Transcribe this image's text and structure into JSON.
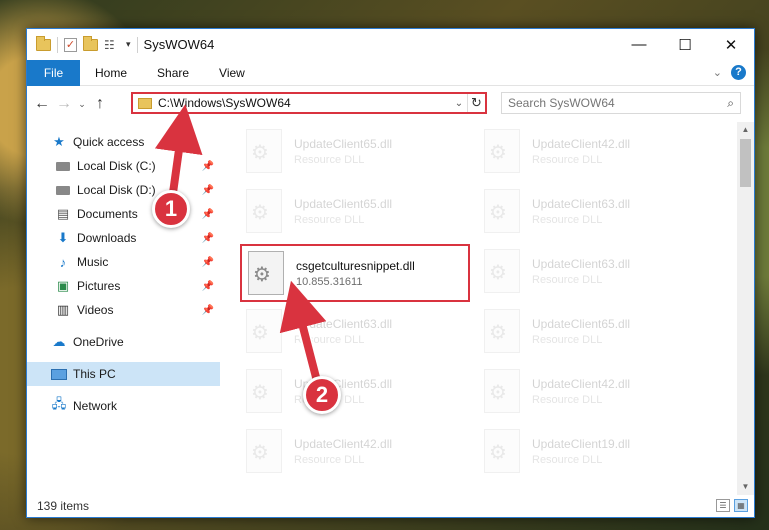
{
  "window": {
    "title": "SysWOW64",
    "controls": {
      "minimize": "—",
      "maximize": "☐",
      "close": "✕"
    }
  },
  "ribbon": {
    "file_tab": "File",
    "tabs": [
      "Home",
      "Share",
      "View"
    ],
    "help": "?"
  },
  "address": {
    "path": "C:\\Windows\\SysWOW64",
    "search_placeholder": "Search SysWOW64"
  },
  "nav": {
    "quick_access": "Quick access",
    "items": [
      {
        "label": "Local Disk (C:)",
        "icon": "drive-icon",
        "pinned": true
      },
      {
        "label": "Local Disk (D:)",
        "icon": "drive-icon",
        "pinned": true
      },
      {
        "label": "Documents",
        "icon": "documents-icon",
        "pinned": true
      },
      {
        "label": "Downloads",
        "icon": "download-icon",
        "pinned": true
      },
      {
        "label": "Music",
        "icon": "music-icon",
        "pinned": true
      },
      {
        "label": "Pictures",
        "icon": "pictures-icon",
        "pinned": true
      },
      {
        "label": "Videos",
        "icon": "videos-icon",
        "pinned": true
      }
    ],
    "onedrive": "OneDrive",
    "this_pc": "This PC",
    "network": "Network"
  },
  "files": {
    "highlighted": {
      "name": "csgetculturesnippet.dll",
      "sub": "10.855.31611"
    },
    "faded": [
      {
        "name": "UpdateClient65.dll",
        "sub": "Resource DLL"
      },
      {
        "name": "UpdateClient42.dll",
        "sub": "Resource DLL"
      },
      {
        "name": "UpdateClient65.dll",
        "sub": "Resource DLL"
      },
      {
        "name": "UpdateClient63.dll",
        "sub": "Resource DLL"
      },
      {
        "name": "UpdateClient63.dll",
        "sub": "Resource DLL"
      },
      {
        "name": "UpdateClient63.dll",
        "sub": "Resource DLL"
      },
      {
        "name": "UpdateClient65.dll",
        "sub": "Resource DLL"
      },
      {
        "name": "UpdateClient65.dll",
        "sub": "Resource DLL"
      },
      {
        "name": "UpdateClient42.dll",
        "sub": "Resource DLL"
      },
      {
        "name": "UpdateClient42.dll",
        "sub": "Resource DLL"
      },
      {
        "name": "UpdateClient19.dll",
        "sub": "Resource DLL"
      }
    ]
  },
  "status": {
    "count": "139 items"
  },
  "annotations": {
    "step1": "1",
    "step2": "2",
    "color": "#d9333f"
  }
}
